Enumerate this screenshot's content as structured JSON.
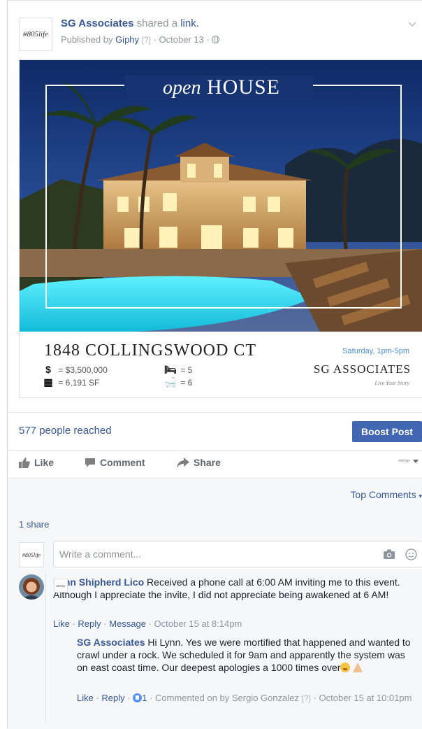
{
  "post": {
    "page_name": "SG Associates",
    "shared_text": " shared a ",
    "link_word": "link.",
    "published_prefix": "Published by ",
    "publisher": "Giphy",
    "help_mark": "[?]",
    "date_text": " · October 13 · ",
    "page_logo_text": "#805life"
  },
  "media": {
    "title_open": "open",
    "title_house": "HOUSE",
    "address": "1848 COLLINGSWOOD CT",
    "price_glyph": "$",
    "price": "= $3,500,000",
    "sqft_glyph": "▦",
    "sqft": "= 6,191 SF",
    "beds_glyph": "🛏",
    "beds": "= 5",
    "baths_glyph": "🛁",
    "baths": "= 6",
    "date_line": "Saturday, 1pm-5pm",
    "brand": "SG ASSOCIATES",
    "tagline": "Live Your Story"
  },
  "stats": {
    "reach": "577 people reached",
    "boost_label": "Boost Post"
  },
  "actions": {
    "like": "Like",
    "comment": "Comment",
    "share": "Share",
    "audience_logo": "#805life"
  },
  "comments_section": {
    "sort_label": "Top Comments",
    "shares": "1 share",
    "composer_avatar_text": "#805life",
    "placeholder": "Write a comment..."
  },
  "comments": [
    {
      "author": "Lynn Shipherd Lico",
      "text": " Received a phone call at 6:00 AM inviting me to this event. Although I appreciate the invite, I did not appreciate being awakened at 6 AM!",
      "like": "Like",
      "reply": "Reply",
      "message": "Message",
      "timestamp": "October 15 at 8:14pm"
    }
  ],
  "reply": {
    "author": "SG Associates",
    "text": " Hi Lynn. Yes we were mortified that happened and wanted to crawl under a rock. We scheduled it for 9am and apparently the system was on east coast time. Our deepest apologies a 1000 times over",
    "like": "Like",
    "reply": "Reply",
    "like_count": "1",
    "commented_on_by": " · Commented on by ",
    "commenter": "Sergio Gonzalez",
    "help_mark": "[?]",
    "timestamp": "October 15 at 10:01pm",
    "avatar_text": "#805life"
  },
  "colors": {
    "link_blue": "#365899",
    "boost_button": "#4267b2",
    "meta_gray": "#90949c",
    "comment_bg": "#f6f7f9"
  }
}
